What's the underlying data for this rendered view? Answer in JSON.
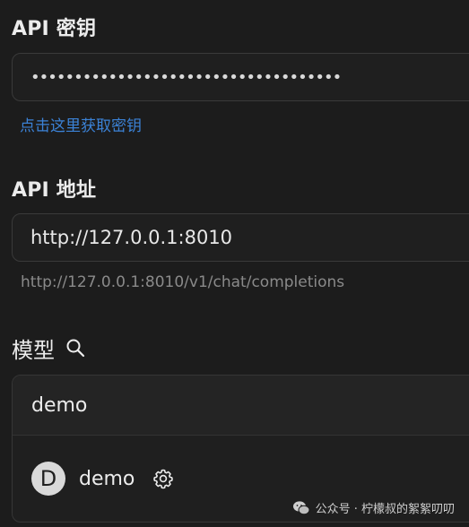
{
  "api_key": {
    "label": "API 密钥",
    "value_masked": "••••••••••••••••••••••••••••••••••••",
    "get_key_link": "点击这里获取密钥"
  },
  "api_address": {
    "label": "API 地址",
    "value": "http://127.0.0.1:8010",
    "preview": "http://127.0.0.1:8010/v1/chat/completions"
  },
  "models": {
    "label": "模型",
    "search_icon": "search-icon",
    "group": {
      "name": "demo",
      "items": [
        {
          "avatar_letter": "D",
          "name": "demo",
          "settings_icon": "gear-icon"
        }
      ]
    }
  },
  "watermark": {
    "icon": "wechat-icon",
    "text": "公众号 · 柠檬叔的絮絮叨叨"
  }
}
